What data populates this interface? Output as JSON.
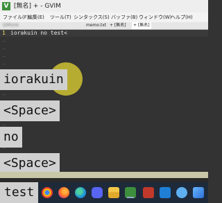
{
  "window": {
    "title": "[無名] + - GVIM",
    "icon_name": "gvim-logo-icon"
  },
  "menubar": {
    "items": [
      "ファイル(F)",
      "編集(E)",
      "ツール(T)",
      "シンタックス(S)",
      "バッファ(B)",
      "ウィンドウ(W)",
      "ヘルプ(H)"
    ]
  },
  "tabline": {
    "first_tab": "\\DM\\mk",
    "tabs": [
      "memo.txt",
      "+ [無名]",
      "+ [無名]"
    ]
  },
  "editor": {
    "line_number": "1",
    "line_text": "iorakuin no test<",
    "tilde": "~"
  },
  "key_overlays": [
    "iorakuin",
    "<Space>",
    "no",
    "<Space>"
  ],
  "taskbar": {
    "search_text": "test",
    "icons": [
      "chrome-icon",
      "firefox-icon",
      "edge-icon",
      "discord-icon",
      "file-explorer-icon",
      "gvim-icon",
      "app-icon",
      "vscode-icon",
      "cloud-app-icon",
      "photos-icon"
    ]
  },
  "colors": {
    "editor_bg": "#333333",
    "line_number": "#e8e070",
    "cursor_highlight": "#c9bd32",
    "key_overlay_bg": "#d0d0d0"
  }
}
